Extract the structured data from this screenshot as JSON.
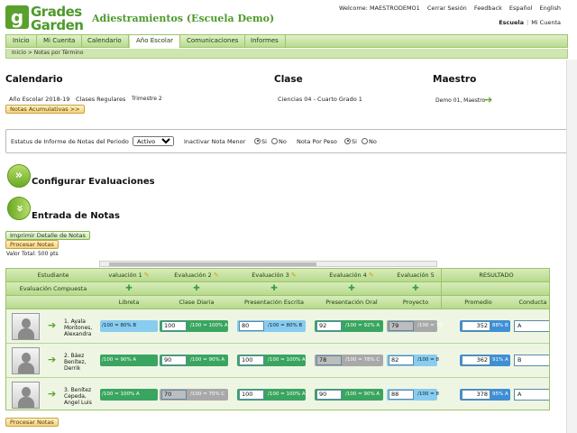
{
  "header": {
    "logo_line1": "Grades",
    "logo_line2": "Garden",
    "logo_glyph": "g",
    "app_title": "Adiestramientos (Escuela Demo)",
    "welcome": "Welcome: MAESTRODEMO1",
    "links": [
      "Cerrar Sesión",
      "Feedback",
      "Español",
      "English"
    ],
    "school_label": "Escuela",
    "school_sep": "|",
    "my_account": "Mi Cuenta"
  },
  "nav": {
    "tabs": [
      "Inicio",
      "Mi Cuenta",
      "Calendario",
      "Año Escolar",
      "Comunicaciones",
      "Informes"
    ],
    "active": "Año Escolar"
  },
  "breadcrumb": {
    "home": "Inicio",
    "sep": ">",
    "current": "Notas por Término"
  },
  "calendar": {
    "title": "Calendario",
    "year": "Año Escolar 2018-19",
    "classes": "Clases Regulares",
    "term": "Trimestre 2",
    "accum_button": "Notas Acumulativas >>"
  },
  "class_info": {
    "title": "Clase",
    "value": "Ciencias 04 -   Cuarto Grado  1"
  },
  "teacher": {
    "title": "Maestro",
    "value": "Demo 01, Maestro"
  },
  "status": {
    "label": "Estatus de Informe de Notas del Periodo",
    "selected": "Activo",
    "inactivate_label": "Inactivar Nota Menor",
    "weight_label": "Nota Por Peso",
    "yes": "Si",
    "no": "No"
  },
  "sections": {
    "configure": "Configurar Evaluaciones",
    "entry": "Entrada de Notas",
    "icon_glyph": "»"
  },
  "actions": {
    "print_detail": "Imprimir Detalle de Notas",
    "process": "Procesar Notas",
    "total_value": "Valor Total:  500 pts"
  },
  "grid": {
    "student_header": "Estudiante",
    "composite_header": "Evaluación Compuesta",
    "result_header": "RESULTADO",
    "eval_headers": [
      "valuación 1",
      "Evaluación 2",
      "Evaluación 3",
      "Evaluación 4",
      "Evaluación 5"
    ],
    "category_headers": [
      "Libreta",
      "Clase Diaria",
      "Presentación Escrita",
      "Presentación Oral",
      "Proyecto"
    ],
    "avg_header": "Promedio",
    "conduct_header": "Conducta",
    "plus_glyph": "✚",
    "pencil_glyph": "✎",
    "arrow_glyph": "➔",
    "students": [
      {
        "name_lines": [
          "1. Ayala",
          "Montones,",
          "Alexandra"
        ],
        "scores": [
          {
            "value": "",
            "text": "/100 = 80% B",
            "color": "blue"
          },
          {
            "value": "100",
            "text": "/100 = 100% A",
            "color": "green"
          },
          {
            "value": "80",
            "text": "/100 = 80% B",
            "color": "blue"
          },
          {
            "value": "92",
            "text": "/100 = 92% A",
            "color": "green"
          },
          {
            "value": "79",
            "text": "/100 = 79",
            "color": "gray"
          }
        ],
        "avg": "352",
        "avg_grade": "88% B",
        "conduct": "A"
      },
      {
        "name_lines": [
          "2. Báez",
          "Benítez,",
          "Derrik"
        ],
        "scores": [
          {
            "value": "",
            "text": "/100 = 90% A",
            "color": "green"
          },
          {
            "value": "90",
            "text": "/100 = 90% A",
            "color": "green"
          },
          {
            "value": "100",
            "text": "/100 = 100% A",
            "color": "green"
          },
          {
            "value": "78",
            "text": "/100 = 78% C",
            "color": "gray"
          },
          {
            "value": "82",
            "text": "/100 = 8",
            "color": "blue"
          }
        ],
        "avg": "362",
        "avg_grade": "91% A",
        "conduct": "B"
      },
      {
        "name_lines": [
          "3. Benítez",
          "Cepeda,",
          "Angel Luis"
        ],
        "scores": [
          {
            "value": "",
            "text": "/100 = 100% A",
            "color": "green"
          },
          {
            "value": "70",
            "text": "/100 = 70% C",
            "color": "gray"
          },
          {
            "value": "100",
            "text": "/100 = 100% A",
            "color": "green"
          },
          {
            "value": "90",
            "text": "/100 = 90% A",
            "color": "green"
          },
          {
            "value": "88",
            "text": "/100 = 8",
            "color": "blue"
          }
        ],
        "avg": "378",
        "avg_grade": "95% A",
        "conduct": "A"
      }
    ]
  }
}
